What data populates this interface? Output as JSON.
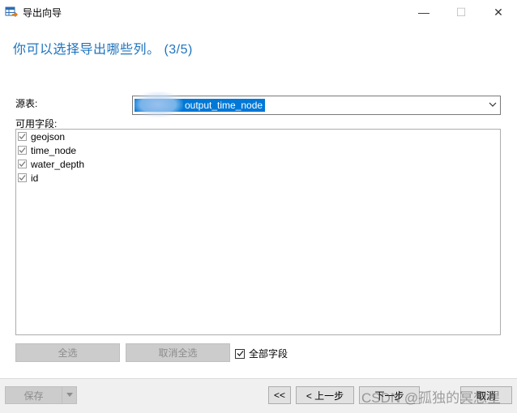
{
  "window": {
    "title": "导出向导",
    "icon": "table-export-icon",
    "controls": {
      "minimize": "—",
      "maximize": "☐",
      "close": "✕"
    }
  },
  "heading": "你可以选择导出哪些列。 (3/5)",
  "source": {
    "label": "源表:",
    "selected_value": "output_time_node"
  },
  "fields": {
    "label": "可用字段:",
    "items": [
      {
        "name": "geojson",
        "checked": true
      },
      {
        "name": "time_node",
        "checked": true
      },
      {
        "name": "water_depth",
        "checked": true
      },
      {
        "name": "id",
        "checked": true
      }
    ]
  },
  "buttons": {
    "select_all": "全选",
    "deselect_all": "取消全选",
    "all_fields": "全部字段",
    "all_fields_checked": true
  },
  "footer": {
    "save": "保存",
    "first": "<<",
    "prev": "< 上一步",
    "next": "下一步",
    "cancel": "取消"
  },
  "watermark": "CSDN @孤独的冥想星",
  "colors": {
    "heading": "#1e73be",
    "selection": "#0078d7"
  }
}
